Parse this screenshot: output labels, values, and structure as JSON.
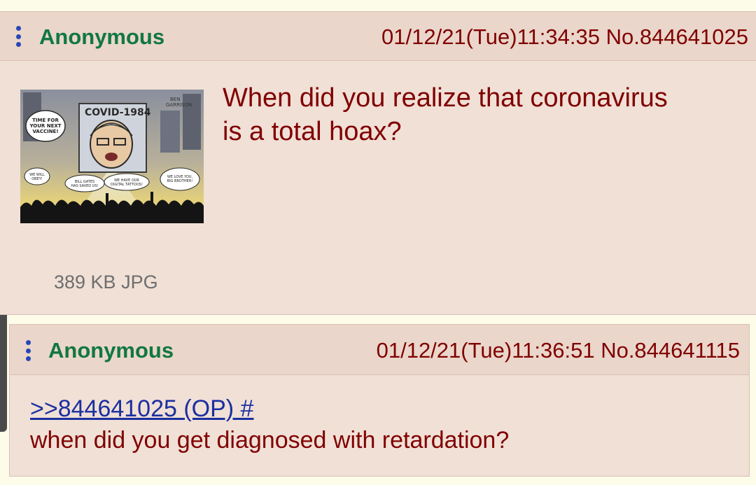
{
  "op": {
    "name": "Anonymous",
    "datetime": "01/12/21(Tue)11:34:35",
    "post_number": "No.844641025",
    "body_lines": [
      "When did you realize that coronavirus",
      "is a total hoax?"
    ],
    "file_info": "389 KB JPG",
    "image": {
      "icon": "cartoon-thumbnail",
      "title": "COVID-1984",
      "signature": "BEN GARRISON",
      "speech_bubbles": [
        "TIME FOR YOUR NEXT VACCINE!",
        "WE WILL OBEY!",
        "BILL GATES HAS SAVED US!",
        "WE HAVE OUR DIGITAL TATTOOS!",
        "WE LOVE YOU, BIG BROTHER!"
      ]
    }
  },
  "reply": {
    "name": "Anonymous",
    "datetime": "01/12/21(Tue)11:36:51",
    "post_number": "No.844641115",
    "quote_link": ">>844641025 (OP) #",
    "body": "when did you get diagnosed with retardation?"
  },
  "colors": {
    "name": "#117743",
    "text": "#800000",
    "link": "#1b2f9f",
    "post_bg": "#f0e0d6",
    "header_bg": "#ead6ca",
    "page_bg": "#fdfce9"
  }
}
